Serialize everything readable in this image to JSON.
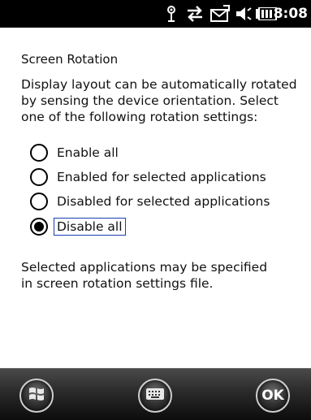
{
  "status_bar": {
    "time": "8:08",
    "icons": [
      "antenna-icon",
      "sync-arrows-icon",
      "messaging-icon",
      "volume-icon",
      "battery-icon"
    ]
  },
  "screen": {
    "title": "Screen Rotation",
    "description_lines": [
      "Display layout can be automatically rotated",
      "by sensing the device orientation.  Select",
      "one of the following rotation settings:"
    ],
    "options": [
      {
        "label": "Enable all",
        "checked": false
      },
      {
        "label": "Enabled for selected applications",
        "checked": false
      },
      {
        "label": "Disabled for selected applications",
        "checked": false
      },
      {
        "label": "Disable all",
        "checked": true
      }
    ],
    "note_lines": [
      "Selected applications may be specified",
      "in screen rotation settings file."
    ]
  },
  "softkeys": {
    "start": "windows-start-icon",
    "keyboard": "keyboard-icon",
    "ok_label": "OK"
  }
}
